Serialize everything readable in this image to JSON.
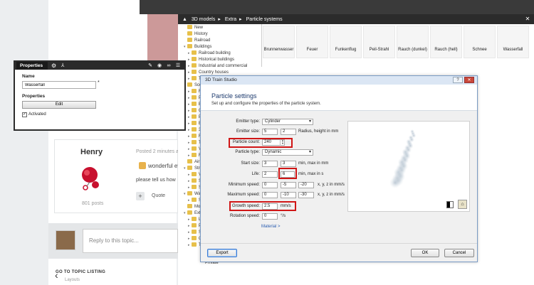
{
  "content_browser": {
    "breadcrumb": [
      "3D models",
      "Extra",
      "Particle systems"
    ],
    "close_label": "✕",
    "tree": [
      {
        "label": "New",
        "arrow": ""
      },
      {
        "label": "History",
        "arrow": ""
      },
      {
        "label": "Railroad",
        "arrow": ""
      },
      {
        "label": "Buildings",
        "arrow": "▾"
      },
      {
        "label": "Railroad building",
        "arrow": "▸"
      },
      {
        "label": "Historical buildings",
        "arrow": "▸"
      },
      {
        "label": "Industrial and commercial",
        "arrow": "▸"
      },
      {
        "label": "Country houses",
        "arrow": "▸"
      },
      {
        "label": "To",
        "arrow": "▸"
      },
      {
        "label": "Scen",
        "arrow": "▸"
      },
      {
        "label": "Fa",
        "arrow": "▸"
      },
      {
        "label": "Pl",
        "arrow": "▸"
      },
      {
        "label": "B",
        "arrow": "▸"
      },
      {
        "label": "C",
        "arrow": "▸"
      },
      {
        "label": "Pe",
        "arrow": "▸"
      },
      {
        "label": "B",
        "arrow": "▸"
      },
      {
        "label": "3",
        "arrow": "▸"
      },
      {
        "label": "R",
        "arrow": "▸"
      },
      {
        "label": "Te",
        "arrow": "▸"
      },
      {
        "label": "Ve",
        "arrow": "▸"
      },
      {
        "label": "Fe",
        "arrow": "▸"
      },
      {
        "label": "Air",
        "arrow": ""
      },
      {
        "label": "Stre",
        "arrow": "▾"
      },
      {
        "label": "Ve",
        "arrow": "▸"
      },
      {
        "label": "Si",
        "arrow": "▸"
      },
      {
        "label": "St",
        "arrow": "▸"
      },
      {
        "label": "Wat",
        "arrow": "▾"
      },
      {
        "label": "Sh",
        "arrow": "▸"
      },
      {
        "label": "Mod",
        "arrow": ""
      },
      {
        "label": "Extr",
        "arrow": "▾"
      },
      {
        "label": "La",
        "arrow": "▸"
      },
      {
        "label": "Pa",
        "arrow": "▸"
      },
      {
        "label": "Sc",
        "arrow": "▸"
      },
      {
        "label": "Ci",
        "arrow": "▸"
      },
      {
        "label": "Te",
        "arrow": "▸"
      }
    ],
    "private_label": "Private",
    "thumbnails": [
      "Brunnenwasser",
      "Feuer",
      "Funkenflug",
      "Peil-Strahl",
      "Rauch (dunkel)",
      "Rauch (hell)",
      "Schnee",
      "Wasserfall"
    ]
  },
  "properties": {
    "tab_label": "Properties",
    "name_label": "Name",
    "name_value": "Wasserfall",
    "required_mark": "*",
    "section_label": "Properties",
    "edit_label": "Edit",
    "activated_label": "Activated",
    "activated_check": "✓"
  },
  "dialog": {
    "window_title": "3D Train Studio",
    "help_label": "?",
    "close_label": "✕",
    "heading": "Particle settings",
    "subheading": "Set up and configure the properties of the particle system.",
    "emitter_type_label": "Emitter type:",
    "emitter_type_value": "Cylinder",
    "emitter_size_label": "Emitter size:",
    "emitter_size_a": "5",
    "emitter_size_b": "2",
    "emitter_size_note": "Radius, height in mm",
    "particle_count_label": "Particle count:",
    "particle_count_value": "240",
    "particle_type_label": "Particle type:",
    "particle_type_value": "Dynamic",
    "start_size_label": "Start size:",
    "start_size_a": "3",
    "start_size_b": "3",
    "start_size_note": "min, max in mm",
    "life_label": "Life:",
    "life_a": "2",
    "life_b": "6",
    "life_note": "min, max in s",
    "min_speed_label": "Minimum speed:",
    "min_speed": [
      "0",
      "-5",
      "-20"
    ],
    "min_speed_note": "x, y, z in mm/s",
    "max_speed_label": "Maximum speed:",
    "max_speed": [
      "0",
      "-10",
      "-30"
    ],
    "max_speed_note": "x, y, z in mm/s",
    "growth_speed_label": "Growth speed:",
    "growth_speed_value": "2.5",
    "growth_speed_note": "mm/s",
    "rotation_speed_label": "Rotation speed:",
    "rotation_speed_value": "0",
    "rotation_speed_note": "°/s",
    "material_link": "Material >",
    "export_label": "Export",
    "ok_label": "OK",
    "cancel_label": "Cancel"
  },
  "forum": {
    "user_name": "Henry",
    "post_date": "Posted 2 minutes a",
    "post_text": "wonderful ef",
    "post_text2": "please tell us how",
    "quote_label": "Quote",
    "plus_label": "+",
    "post_count": "801 posts",
    "reply_placeholder": "Reply to this topic...",
    "goto_label": "GO TO TOPIC LISTING",
    "goto_sub": "Layouts"
  },
  "colors": {
    "highlight": "#d01616",
    "dialog_heading": "#1e3b6e",
    "link": "#2a5db0"
  }
}
